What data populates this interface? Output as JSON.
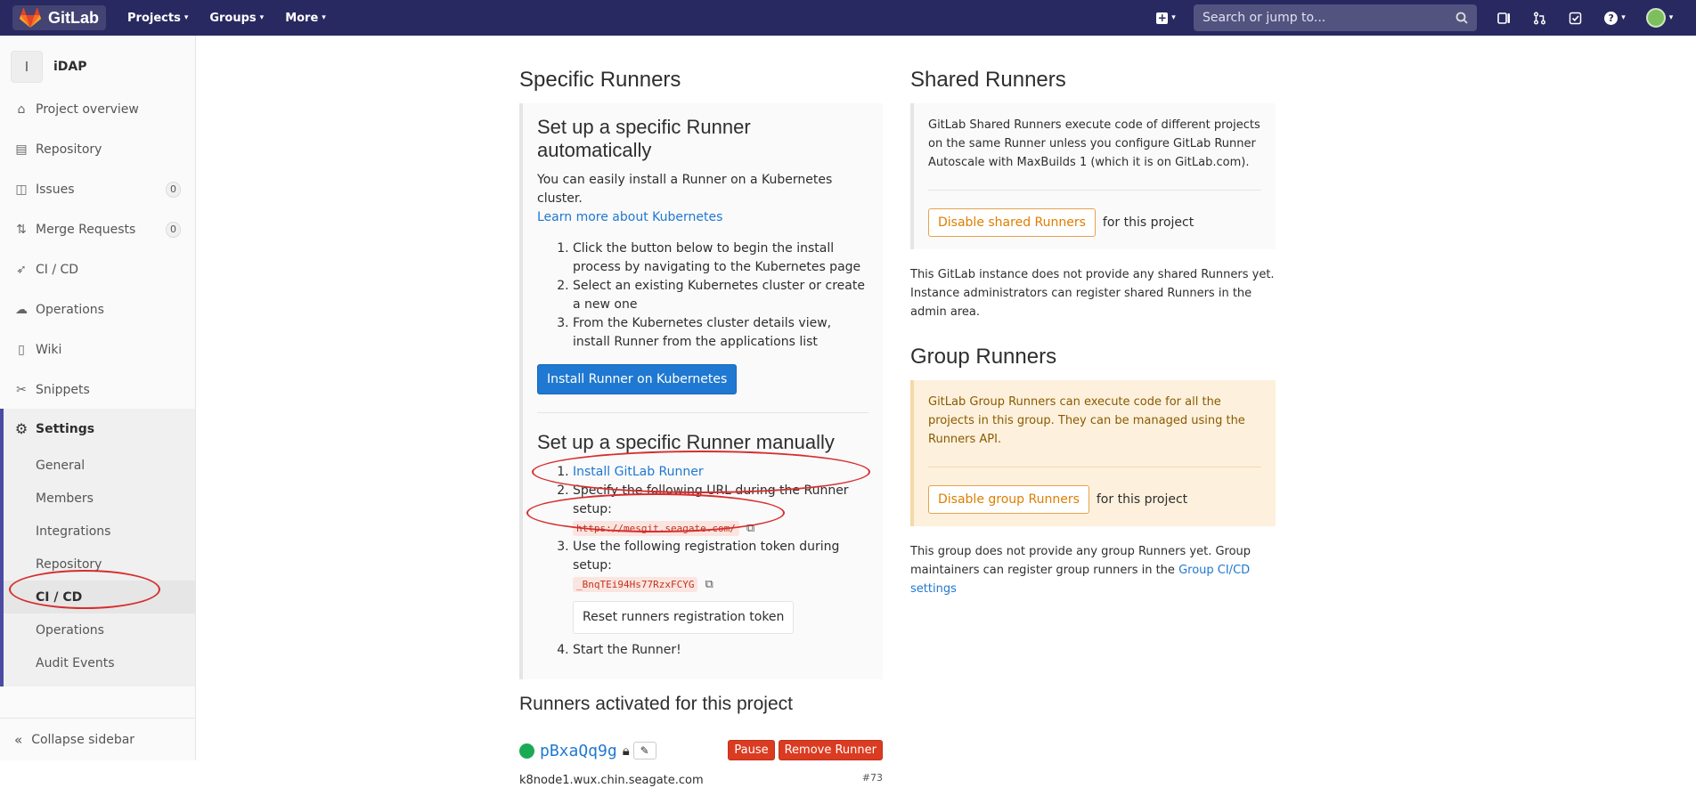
{
  "navbar": {
    "brand": "GitLab",
    "links": [
      "Projects",
      "Groups",
      "More"
    ],
    "search_placeholder": "Search or jump to..."
  },
  "sidebar": {
    "project_initial": "I",
    "project_name": "iDAP",
    "items": [
      {
        "label": "Project overview",
        "icon": "home-icon"
      },
      {
        "label": "Repository",
        "icon": "doc-icon"
      },
      {
        "label": "Issues",
        "icon": "issues-icon",
        "badge": "0"
      },
      {
        "label": "Merge Requests",
        "icon": "merge-request-icon",
        "badge": "0"
      },
      {
        "label": "CI / CD",
        "icon": "rocket-icon"
      },
      {
        "label": "Operations",
        "icon": "cloud-gear-icon"
      },
      {
        "label": "Wiki",
        "icon": "book-icon"
      },
      {
        "label": "Snippets",
        "icon": "scissors-icon"
      }
    ],
    "settings_label": "Settings",
    "settings_sub": [
      "General",
      "Members",
      "Integrations",
      "Repository",
      "CI / CD",
      "Operations",
      "Audit Events"
    ],
    "active_sub": "CI / CD",
    "collapse_label": "Collapse sidebar"
  },
  "specific": {
    "title": "Specific Runners",
    "auto_title": "Set up a specific Runner automatically",
    "auto_text": "You can easily install a Runner on a Kubernetes cluster.",
    "auto_link": "Learn more about Kubernetes",
    "auto_steps": [
      "Click the button below to begin the install process by navigating to the Kubernetes page",
      "Select an existing Kubernetes cluster or create a new one",
      "From the Kubernetes cluster details view, install Runner from the applications list"
    ],
    "install_button": "Install Runner on Kubernetes",
    "manual_title": "Set up a specific Runner manually",
    "manual_step1_link": "Install GitLab Runner",
    "manual_step2": "Specify the following URL during the Runner setup:",
    "url": "https://mesgit.seagate.com/",
    "manual_step3": "Use the following registration token during setup:",
    "token": "_BnqTEi94Hs77RzxFCYG",
    "reset_button": "Reset runners registration token",
    "manual_step4": "Start the Runner!"
  },
  "activated": {
    "title": "Runners activated for this project",
    "runner_id": "pBxaQq9g",
    "pause_button": "Pause",
    "remove_button": "Remove Runner",
    "host": "k8node1.wux.chin.seagate.com",
    "number": "#73"
  },
  "shared": {
    "title": "Shared Runners",
    "text": "GitLab Shared Runners execute code of different projects on the same Runner unless you configure GitLab Runner Autoscale with MaxBuilds 1 (which it is on GitLab.com).",
    "disable_button": "Disable shared Runners",
    "for_project": "for this project",
    "note": "This GitLab instance does not provide any shared Runners yet. Instance administrators can register shared Runners in the admin area."
  },
  "group": {
    "title": "Group Runners",
    "text": "GitLab Group Runners can execute code for all the projects in this group. They can be managed using the Runners API.",
    "disable_button": "Disable group Runners",
    "for_project": "for this project",
    "note_text": "This group does not provide any group Runners yet. Group maintainers can register group runners in the",
    "note_link": "Group CI/CD settings"
  },
  "colors": {
    "navbar": "#292961",
    "link": "#1f78d1",
    "primary_button": "#1f78d1",
    "danger": "#db3b21",
    "warning": "#de7e00",
    "online": "#1aaa55"
  }
}
